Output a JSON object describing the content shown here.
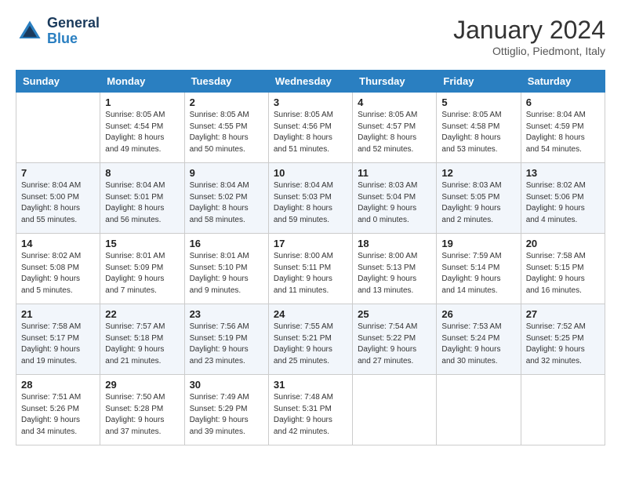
{
  "header": {
    "logo_line1": "General",
    "logo_line2": "Blue",
    "month_title": "January 2024",
    "subtitle": "Ottiglio, Piedmont, Italy"
  },
  "calendar": {
    "days_of_week": [
      "Sunday",
      "Monday",
      "Tuesday",
      "Wednesday",
      "Thursday",
      "Friday",
      "Saturday"
    ],
    "weeks": [
      [
        {
          "day": "",
          "info": ""
        },
        {
          "day": "1",
          "info": "Sunrise: 8:05 AM\nSunset: 4:54 PM\nDaylight: 8 hours\nand 49 minutes."
        },
        {
          "day": "2",
          "info": "Sunrise: 8:05 AM\nSunset: 4:55 PM\nDaylight: 8 hours\nand 50 minutes."
        },
        {
          "day": "3",
          "info": "Sunrise: 8:05 AM\nSunset: 4:56 PM\nDaylight: 8 hours\nand 51 minutes."
        },
        {
          "day": "4",
          "info": "Sunrise: 8:05 AM\nSunset: 4:57 PM\nDaylight: 8 hours\nand 52 minutes."
        },
        {
          "day": "5",
          "info": "Sunrise: 8:05 AM\nSunset: 4:58 PM\nDaylight: 8 hours\nand 53 minutes."
        },
        {
          "day": "6",
          "info": "Sunrise: 8:04 AM\nSunset: 4:59 PM\nDaylight: 8 hours\nand 54 minutes."
        }
      ],
      [
        {
          "day": "7",
          "info": "Sunrise: 8:04 AM\nSunset: 5:00 PM\nDaylight: 8 hours\nand 55 minutes."
        },
        {
          "day": "8",
          "info": "Sunrise: 8:04 AM\nSunset: 5:01 PM\nDaylight: 8 hours\nand 56 minutes."
        },
        {
          "day": "9",
          "info": "Sunrise: 8:04 AM\nSunset: 5:02 PM\nDaylight: 8 hours\nand 58 minutes."
        },
        {
          "day": "10",
          "info": "Sunrise: 8:04 AM\nSunset: 5:03 PM\nDaylight: 8 hours\nand 59 minutes."
        },
        {
          "day": "11",
          "info": "Sunrise: 8:03 AM\nSunset: 5:04 PM\nDaylight: 9 hours\nand 0 minutes."
        },
        {
          "day": "12",
          "info": "Sunrise: 8:03 AM\nSunset: 5:05 PM\nDaylight: 9 hours\nand 2 minutes."
        },
        {
          "day": "13",
          "info": "Sunrise: 8:02 AM\nSunset: 5:06 PM\nDaylight: 9 hours\nand 4 minutes."
        }
      ],
      [
        {
          "day": "14",
          "info": "Sunrise: 8:02 AM\nSunset: 5:08 PM\nDaylight: 9 hours\nand 5 minutes."
        },
        {
          "day": "15",
          "info": "Sunrise: 8:01 AM\nSunset: 5:09 PM\nDaylight: 9 hours\nand 7 minutes."
        },
        {
          "day": "16",
          "info": "Sunrise: 8:01 AM\nSunset: 5:10 PM\nDaylight: 9 hours\nand 9 minutes."
        },
        {
          "day": "17",
          "info": "Sunrise: 8:00 AM\nSunset: 5:11 PM\nDaylight: 9 hours\nand 11 minutes."
        },
        {
          "day": "18",
          "info": "Sunrise: 8:00 AM\nSunset: 5:13 PM\nDaylight: 9 hours\nand 13 minutes."
        },
        {
          "day": "19",
          "info": "Sunrise: 7:59 AM\nSunset: 5:14 PM\nDaylight: 9 hours\nand 14 minutes."
        },
        {
          "day": "20",
          "info": "Sunrise: 7:58 AM\nSunset: 5:15 PM\nDaylight: 9 hours\nand 16 minutes."
        }
      ],
      [
        {
          "day": "21",
          "info": "Sunrise: 7:58 AM\nSunset: 5:17 PM\nDaylight: 9 hours\nand 19 minutes."
        },
        {
          "day": "22",
          "info": "Sunrise: 7:57 AM\nSunset: 5:18 PM\nDaylight: 9 hours\nand 21 minutes."
        },
        {
          "day": "23",
          "info": "Sunrise: 7:56 AM\nSunset: 5:19 PM\nDaylight: 9 hours\nand 23 minutes."
        },
        {
          "day": "24",
          "info": "Sunrise: 7:55 AM\nSunset: 5:21 PM\nDaylight: 9 hours\nand 25 minutes."
        },
        {
          "day": "25",
          "info": "Sunrise: 7:54 AM\nSunset: 5:22 PM\nDaylight: 9 hours\nand 27 minutes."
        },
        {
          "day": "26",
          "info": "Sunrise: 7:53 AM\nSunset: 5:24 PM\nDaylight: 9 hours\nand 30 minutes."
        },
        {
          "day": "27",
          "info": "Sunrise: 7:52 AM\nSunset: 5:25 PM\nDaylight: 9 hours\nand 32 minutes."
        }
      ],
      [
        {
          "day": "28",
          "info": "Sunrise: 7:51 AM\nSunset: 5:26 PM\nDaylight: 9 hours\nand 34 minutes."
        },
        {
          "day": "29",
          "info": "Sunrise: 7:50 AM\nSunset: 5:28 PM\nDaylight: 9 hours\nand 37 minutes."
        },
        {
          "day": "30",
          "info": "Sunrise: 7:49 AM\nSunset: 5:29 PM\nDaylight: 9 hours\nand 39 minutes."
        },
        {
          "day": "31",
          "info": "Sunrise: 7:48 AM\nSunset: 5:31 PM\nDaylight: 9 hours\nand 42 minutes."
        },
        {
          "day": "",
          "info": ""
        },
        {
          "day": "",
          "info": ""
        },
        {
          "day": "",
          "info": ""
        }
      ]
    ]
  }
}
